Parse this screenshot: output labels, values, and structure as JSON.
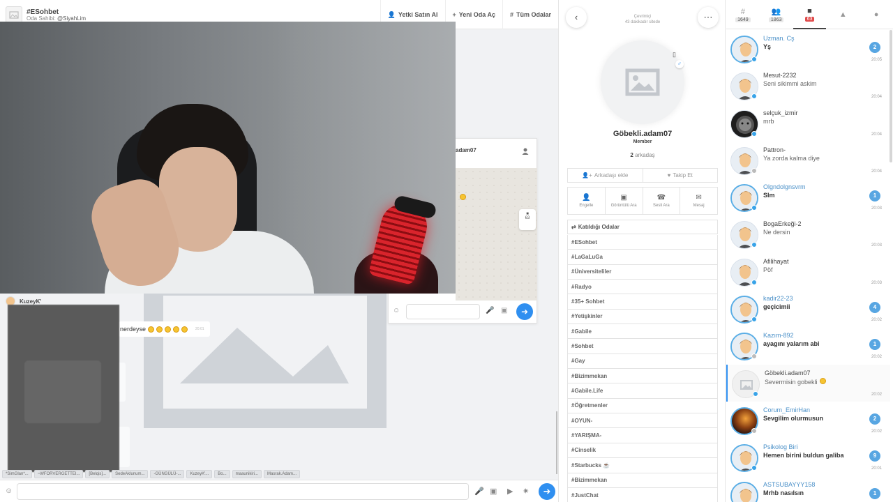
{
  "room": {
    "title": "#ESohbet",
    "owner_label": "Oda Sahibi:",
    "owner_name": "@SiyahLim"
  },
  "top_actions": [
    {
      "icon": "user-shield-icon",
      "label": "Yetki Satın Al"
    },
    {
      "icon": "plus-icon",
      "label": "Yeni Oda Aç"
    },
    {
      "icon": "hash-icon",
      "label": "Tüm Odalar"
    }
  ],
  "pm": {
    "name_fragment": "adam07",
    "float_count": "63"
  },
  "chat": {
    "user": "KuzeyK'",
    "bubble_text": "nerdeyse",
    "bubble_time": "20:01"
  },
  "tags": [
    "*SimGlan*...",
    "~WFORVERGETTEI...",
    "[Belqis]...",
    "SedeAklunum...",
    "-GÜNGÜLÜ-...",
    "KuzeyK'...",
    "Bo...",
    "maaunikiri...",
    "Masrak.Adam..."
  ],
  "profile": {
    "status": "Çevrimiçi",
    "last_seen": "43 dakikadır sitede",
    "name": "Göbekli.adam07",
    "role": "Member",
    "friends_count": "2",
    "friends_label": "arkadaş",
    "add_friend": "Arkadaşı ekle",
    "follow": "Takip Et",
    "actions": [
      {
        "icon": "block-user-icon",
        "label": "Engelle"
      },
      {
        "icon": "video-call-icon",
        "label": "Görüntülü Ara"
      },
      {
        "icon": "phone-icon",
        "label": "Sesli Ara"
      },
      {
        "icon": "message-icon",
        "label": "Mesaj"
      }
    ],
    "rooms_title": "Katıldığı Odalar",
    "rooms": [
      "#ESohbet",
      "#LaGaLuGa",
      "#Üniversiteliler",
      "#Radyo",
      "#35+ Sohbet",
      "#Yetişkinler",
      "#Gabile",
      "#Sohbet",
      "#Gay",
      "#Bizimmekan",
      "#Gabile.Life",
      "#Öğretmenler",
      "#OYUN-",
      "#YARIŞMA-",
      "#Cinselik",
      "#Starbucks",
      "#Bizimmekan",
      "#JustChat"
    ]
  },
  "tabs": [
    {
      "icon": "hash-icon",
      "count": "1649",
      "active": false
    },
    {
      "icon": "users-icon",
      "count": "1863",
      "active": false
    },
    {
      "icon": "chat-icon",
      "count": "63",
      "active": true
    },
    {
      "icon": "bell-icon",
      "count": "",
      "active": false
    },
    {
      "icon": "user-icon",
      "count": "",
      "active": false
    }
  ],
  "conversations": [
    {
      "name": "Uzman. Cş",
      "message": "Yş",
      "badge": "2",
      "time": "20:05",
      "unread": true,
      "avatar": "default",
      "online": true
    },
    {
      "name": "Mesut-2232",
      "message": "Seni sikimmi askim",
      "badge": "",
      "time": "20:04",
      "unread": false,
      "avatar": "default",
      "online": true
    },
    {
      "name": "selçuk_izmir",
      "message": "mrb",
      "badge": "",
      "time": "20:04",
      "unread": false,
      "avatar": "dark",
      "online": true
    },
    {
      "name": "Pattron-",
      "message": "Ya zorda kalma diye",
      "badge": "",
      "time": "20:04",
      "unread": false,
      "avatar": "default",
      "online": false
    },
    {
      "name": "Olgndolgnsvrm",
      "message": "Slm",
      "badge": "1",
      "time": "20:03",
      "unread": true,
      "avatar": "default",
      "online": true
    },
    {
      "name": "BogaErkeği-2",
      "message": "Ne dersin",
      "badge": "",
      "time": "20:03",
      "unread": false,
      "avatar": "default",
      "online": true
    },
    {
      "name": "Afilihayat",
      "message": "Pöf",
      "badge": "",
      "time": "20:03",
      "unread": false,
      "avatar": "default",
      "online": true
    },
    {
      "name": "kadir22-23",
      "message": "geçicimii",
      "badge": "4",
      "time": "20:02",
      "unread": true,
      "avatar": "default",
      "online": true
    },
    {
      "name": "Kazım-892",
      "message": "ayagını yalarım abi",
      "badge": "1",
      "time": "20:02",
      "unread": true,
      "avatar": "default",
      "online": false
    },
    {
      "name": "Göbekli.adam07",
      "message": "Severmisin gobekli",
      "badge": "",
      "time": "20:02",
      "unread": false,
      "avatar": "gray",
      "online": true,
      "selected": true
    },
    {
      "name": "Corum_EmirHan",
      "message": "Sevgilim olurmusun",
      "badge": "2",
      "time": "20:02",
      "unread": true,
      "avatar": "sunset",
      "online": false
    },
    {
      "name": "Psikolog Biri",
      "message": "Hemen birini buldun galiba",
      "badge": "9",
      "time": "20:01",
      "unread": true,
      "avatar": "default",
      "online": true
    },
    {
      "name": "ASTSUBAYYY158",
      "message": "Mrhb nasılsın",
      "badge": "1",
      "time": "",
      "unread": true,
      "avatar": "default",
      "online": true
    }
  ]
}
